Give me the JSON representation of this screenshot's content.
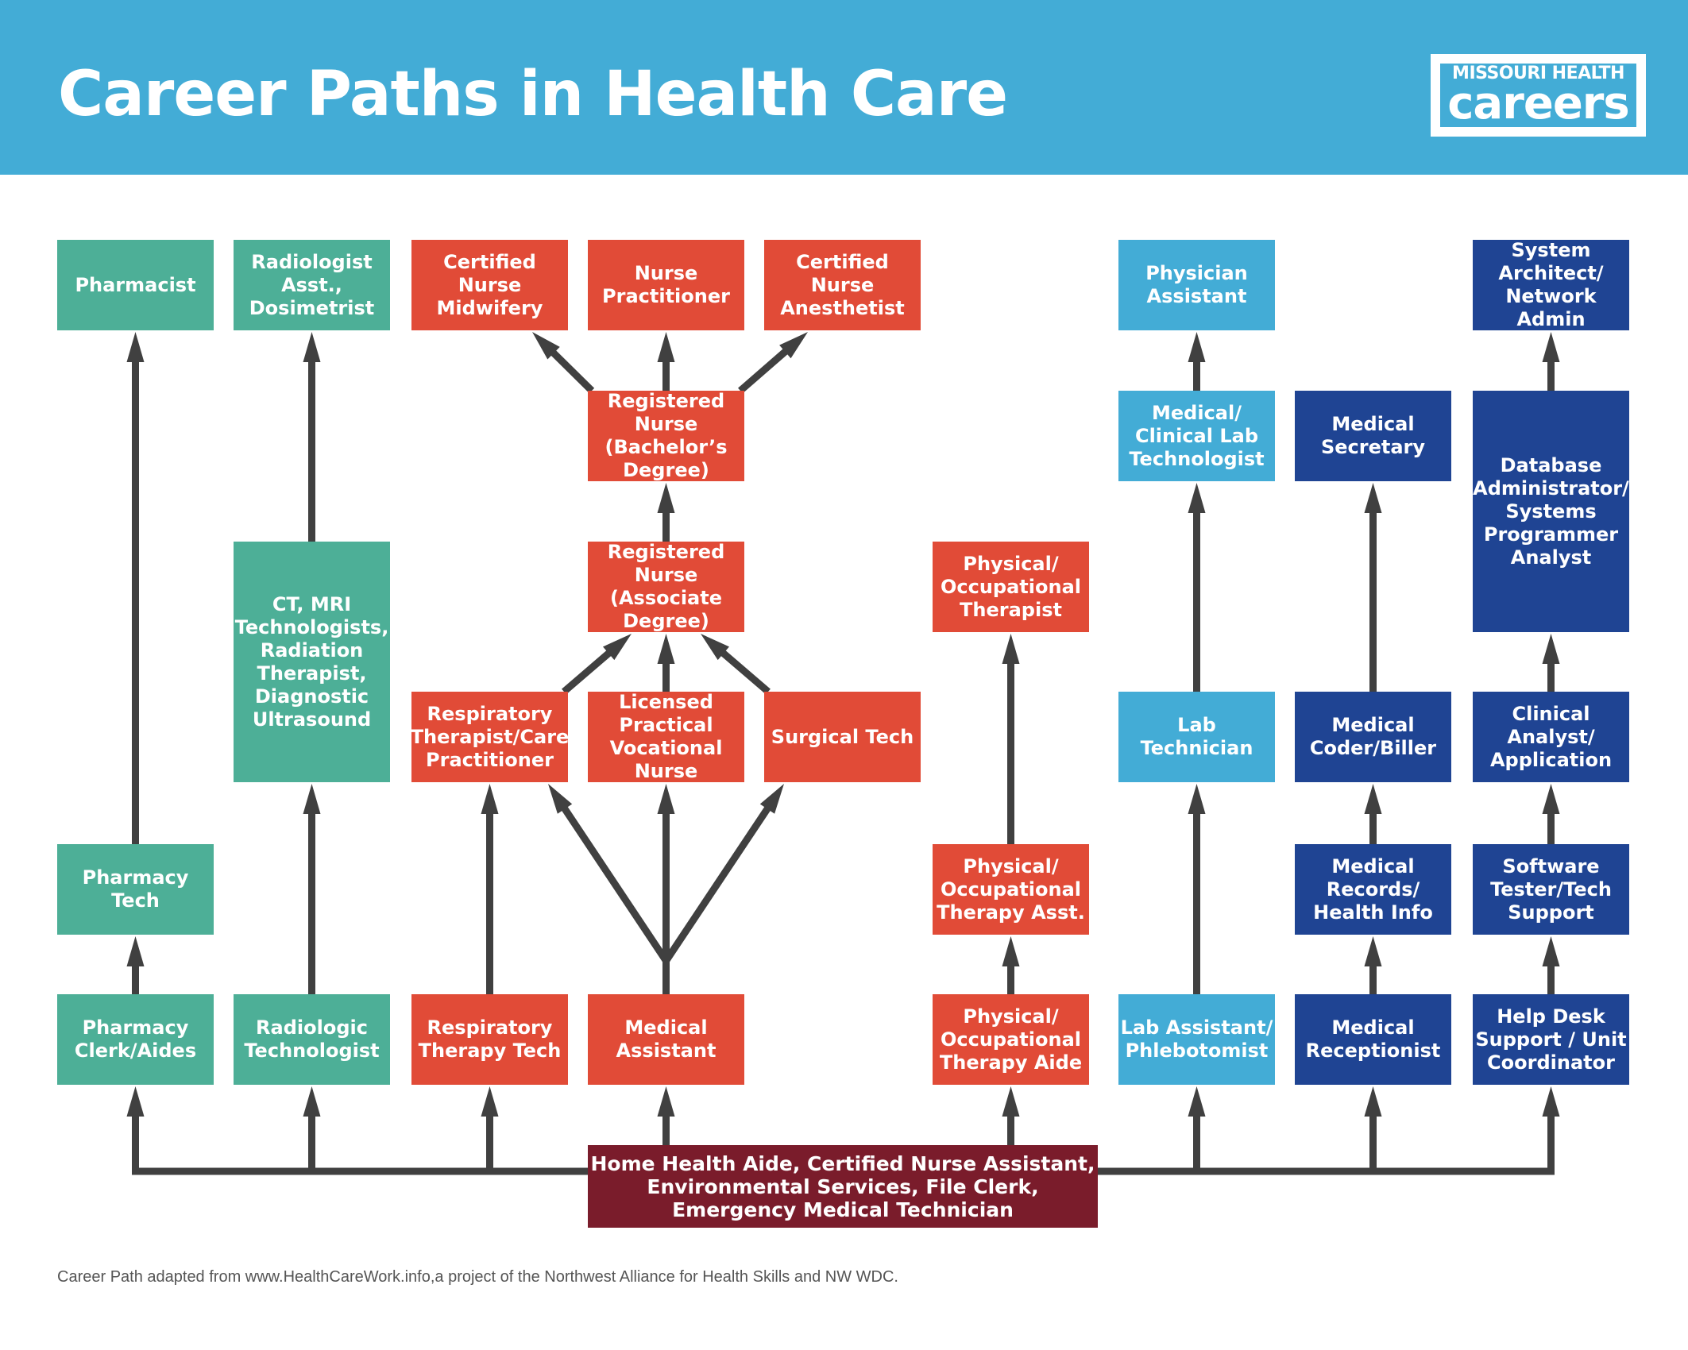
{
  "header": {
    "title": "Career Paths in Health Care",
    "logo_top": "MISSOURI HEALTH",
    "logo_bottom": "careers"
  },
  "colors": {
    "header": "#43acd6",
    "pharmacy_radiology": "#4daf97",
    "nursing_therapy": "#e14b37",
    "lab_physician": "#43acd6",
    "admin_it": "#1f4493",
    "entry": "#7a1c2b",
    "arrow": "#404040"
  },
  "nodes": [
    {
      "id": "pharmacist",
      "label": "Pharmacist",
      "group": "pharmacy_radiology",
      "col": 0,
      "row": 0
    },
    {
      "id": "radiologist-asst",
      "label": "Radiologist\nAsst.,\nDosimetrist",
      "group": "pharmacy_radiology",
      "col": 1,
      "row": 0
    },
    {
      "id": "certified-nurse-midwifery",
      "label": "Certified\nNurse\nMidwifery",
      "group": "nursing_therapy",
      "col": 2,
      "row": 0
    },
    {
      "id": "nurse-practitioner",
      "label": "Nurse\nPractitioner",
      "group": "nursing_therapy",
      "col": 3,
      "row": 0
    },
    {
      "id": "certified-nurse-anesthetist",
      "label": "Certified\nNurse\nAnesthetist",
      "group": "nursing_therapy",
      "col": 4,
      "row": 0
    },
    {
      "id": "physician-assistant",
      "label": "Physician\nAssistant",
      "group": "lab_physician",
      "col": 6,
      "row": 0
    },
    {
      "id": "system-architect",
      "label": "System\nArchitect/\nNetwork\nAdmin",
      "group": "admin_it",
      "col": 8,
      "row": 0
    },
    {
      "id": "rn-bachelors",
      "label": "Registered\nNurse\n(Bachelor’s\nDegree)",
      "group": "nursing_therapy",
      "col": 3,
      "row": 1
    },
    {
      "id": "clinical-lab-technologist",
      "label": "Medical/\nClinical Lab\nTechnologist",
      "group": "lab_physician",
      "col": 6,
      "row": 1
    },
    {
      "id": "medical-secretary",
      "label": "Medical\nSecretary",
      "group": "admin_it",
      "col": 7,
      "row": 1
    },
    {
      "id": "database-administrator",
      "label": "Database\nAdministrator/\nSystems\nProgrammer\nAnalyst",
      "group": "admin_it",
      "col": 8,
      "row": 1,
      "span": 2
    },
    {
      "id": "ct-mri",
      "label": "CT, MRI\nTechnologists,\nRadiation\nTherapist,\nDiagnostic\nUltrasound",
      "group": "pharmacy_radiology",
      "col": 1,
      "row": 2,
      "span": 2
    },
    {
      "id": "rn-associate",
      "label": "Registered\nNurse\n(Associate\nDegree)",
      "group": "nursing_therapy",
      "col": 3,
      "row": 2
    },
    {
      "id": "pt-ot-therapist",
      "label": "Physical/\nOccupational\nTherapist",
      "group": "nursing_therapy",
      "col": 5,
      "row": 2
    },
    {
      "id": "respiratory-therapist",
      "label": "Respiratory\nTherapist/Care\nPractitioner",
      "group": "nursing_therapy",
      "col": 2,
      "row": 3
    },
    {
      "id": "lpn",
      "label": "Licensed\nPractical\nVocational\nNurse",
      "group": "nursing_therapy",
      "col": 3,
      "row": 3
    },
    {
      "id": "surgical-tech",
      "label": "Surgical Tech",
      "group": "nursing_therapy",
      "col": 4,
      "row": 3
    },
    {
      "id": "lab-technician",
      "label": "Lab\nTechnician",
      "group": "lab_physician",
      "col": 6,
      "row": 3
    },
    {
      "id": "medical-coder",
      "label": "Medical\nCoder/Biller",
      "group": "admin_it",
      "col": 7,
      "row": 3
    },
    {
      "id": "clinical-analyst",
      "label": "Clinical\nAnalyst/\nApplication",
      "group": "admin_it",
      "col": 8,
      "row": 3
    },
    {
      "id": "pharmacy-tech",
      "label": "Pharmacy\nTech",
      "group": "pharmacy_radiology",
      "col": 0,
      "row": 4
    },
    {
      "id": "pt-ot-asst",
      "label": "Physical/\nOccupational\nTherapy Asst.",
      "group": "nursing_therapy",
      "col": 5,
      "row": 4
    },
    {
      "id": "medical-records",
      "label": "Medical\nRecords/\nHealth Info",
      "group": "admin_it",
      "col": 7,
      "row": 4
    },
    {
      "id": "software-tester",
      "label": "Software\nTester/Tech\nSupport",
      "group": "admin_it",
      "col": 8,
      "row": 4
    },
    {
      "id": "pharmacy-clerk",
      "label": "Pharmacy\nClerk/Aides",
      "group": "pharmacy_radiology",
      "col": 0,
      "row": 5
    },
    {
      "id": "radiologic-technologist",
      "label": "Radiologic\nTechnologist",
      "group": "pharmacy_radiology",
      "col": 1,
      "row": 5
    },
    {
      "id": "respiratory-therapy-tech",
      "label": "Respiratory\nTherapy Tech",
      "group": "nursing_therapy",
      "col": 2,
      "row": 5
    },
    {
      "id": "medical-assistant",
      "label": "Medical\nAssistant",
      "group": "nursing_therapy",
      "col": 3,
      "row": 5
    },
    {
      "id": "pt-ot-aide",
      "label": "Physical/\nOccupational\nTherapy Aide",
      "group": "nursing_therapy",
      "col": 5,
      "row": 5
    },
    {
      "id": "lab-assistant",
      "label": "Lab Assistant/\nPhlebotomist",
      "group": "lab_physician",
      "col": 6,
      "row": 5
    },
    {
      "id": "medical-receptionist",
      "label": "Medical\nReceptionist",
      "group": "admin_it",
      "col": 7,
      "row": 5
    },
    {
      "id": "help-desk",
      "label": "Help Desk\nSupport / Unit\nCoordinator",
      "group": "admin_it",
      "col": 8,
      "row": 5
    }
  ],
  "entry": {
    "label": "Home Health Aide, Certified Nurse Assistant,\nEnvironmental Services, File Clerk,\nEmergency Medical Technician",
    "feeds": [
      "pharmacy-clerk",
      "radiologic-technologist",
      "respiratory-therapy-tech",
      "medical-assistant",
      "pt-ot-aide",
      "lab-assistant",
      "medical-receptionist",
      "help-desk"
    ]
  },
  "edges": [
    [
      "pharmacy-clerk",
      "pharmacy-tech"
    ],
    [
      "pharmacy-tech",
      "pharmacist"
    ],
    [
      "radiologic-technologist",
      "ct-mri"
    ],
    [
      "ct-mri",
      "radiologist-asst"
    ],
    [
      "respiratory-therapy-tech",
      "respiratory-therapist"
    ],
    [
      "medical-assistant",
      "respiratory-therapist"
    ],
    [
      "medical-assistant",
      "lpn"
    ],
    [
      "medical-assistant",
      "surgical-tech"
    ],
    [
      "respiratory-therapist",
      "rn-associate"
    ],
    [
      "lpn",
      "rn-associate"
    ],
    [
      "surgical-tech",
      "rn-associate"
    ],
    [
      "rn-associate",
      "rn-bachelors"
    ],
    [
      "rn-bachelors",
      "certified-nurse-midwifery"
    ],
    [
      "rn-bachelors",
      "nurse-practitioner"
    ],
    [
      "rn-bachelors",
      "certified-nurse-anesthetist"
    ],
    [
      "pt-ot-aide",
      "pt-ot-asst"
    ],
    [
      "pt-ot-asst",
      "pt-ot-therapist"
    ],
    [
      "lab-assistant",
      "lab-technician"
    ],
    [
      "lab-technician",
      "clinical-lab-technologist"
    ],
    [
      "clinical-lab-technologist",
      "physician-assistant"
    ],
    [
      "medical-receptionist",
      "medical-records"
    ],
    [
      "medical-records",
      "medical-coder"
    ],
    [
      "medical-coder",
      "medical-secretary"
    ],
    [
      "help-desk",
      "software-tester"
    ],
    [
      "software-tester",
      "clinical-analyst"
    ],
    [
      "clinical-analyst",
      "database-administrator"
    ],
    [
      "database-administrator",
      "system-architect"
    ]
  ],
  "footer": "Career Path adapted from www.HealthCareWork.info,a project of the Northwest Alliance for Health Skills and NW WDC."
}
